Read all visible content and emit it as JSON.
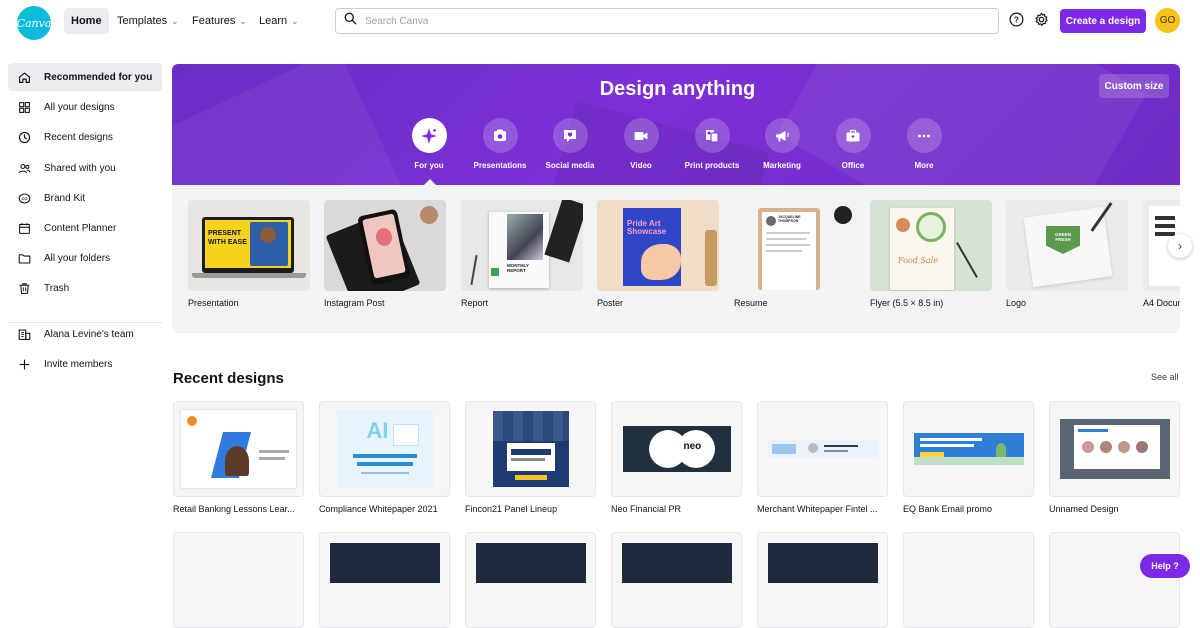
{
  "header": {
    "logo_text": "Canva",
    "nav": [
      {
        "label": "Home"
      },
      {
        "label": "Templates"
      },
      {
        "label": "Features"
      },
      {
        "label": "Learn"
      }
    ],
    "search_placeholder": "Search Canva",
    "create_label": "Create a design",
    "avatar_initials": "GO"
  },
  "sidebar": {
    "items": [
      {
        "label": "Recommended for you",
        "icon": "home-icon"
      },
      {
        "label": "All your designs",
        "icon": "grid-icon"
      },
      {
        "label": "Recent designs",
        "icon": "clock-icon"
      },
      {
        "label": "Shared with you",
        "icon": "people-icon"
      },
      {
        "label": "Brand Kit",
        "icon": "brand-kit-icon"
      },
      {
        "label": "Content Planner",
        "icon": "calendar-icon"
      },
      {
        "label": "All your folders",
        "icon": "folder-icon"
      },
      {
        "label": "Trash",
        "icon": "trash-icon"
      }
    ],
    "team": {
      "label": "Alana Levine's team"
    },
    "invite": {
      "label": "Invite members"
    }
  },
  "hero": {
    "title": "Design anything",
    "custom_size_label": "Custom size",
    "categories": [
      {
        "label": "For you",
        "icon": "sparkle-icon"
      },
      {
        "label": "Presentations",
        "icon": "presentation-icon"
      },
      {
        "label": "Social media",
        "icon": "heart-chat-icon"
      },
      {
        "label": "Video",
        "icon": "video-camera-icon"
      },
      {
        "label": "Print products",
        "icon": "print-icon"
      },
      {
        "label": "Marketing",
        "icon": "megaphone-icon"
      },
      {
        "label": "Office",
        "icon": "briefcase-icon"
      },
      {
        "label": "More",
        "icon": "more-dots-icon"
      }
    ]
  },
  "templates": [
    {
      "label": "Presentation",
      "thumb_text": "PRESENT WITH EASE"
    },
    {
      "label": "Instagram Post"
    },
    {
      "label": "Report",
      "thumb_text": "MONTHLY REPORT"
    },
    {
      "label": "Poster",
      "thumb_text": "Pride Art Showcase"
    },
    {
      "label": "Resume",
      "thumb_text": "JACQUELINE THOMPSON"
    },
    {
      "label": "Flyer (5.5 × 8.5 in)",
      "thumb_text": "Food Sale"
    },
    {
      "label": "Logo",
      "thumb_text": "GREEN FRESH"
    },
    {
      "label": "A4 Docum"
    }
  ],
  "recent": {
    "title": "Recent designs",
    "see_all": "See all",
    "items": [
      {
        "label": "Retail Banking Lessons Lear..."
      },
      {
        "label": "Compliance Whitepaper 2021"
      },
      {
        "label": "Fincon21 Panel Lineup"
      },
      {
        "label": "Neo Financial PR"
      },
      {
        "label": "Merchant Whitepaper Fintel ..."
      },
      {
        "label": "EQ Bank Email promo"
      },
      {
        "label": "Unnamed Design"
      }
    ]
  },
  "help_label": "Help ?",
  "colors": {
    "brand_purple": "#7d2ae8",
    "hero_bg": "#6f2bc4",
    "canva_teal": "#00c4cc"
  }
}
